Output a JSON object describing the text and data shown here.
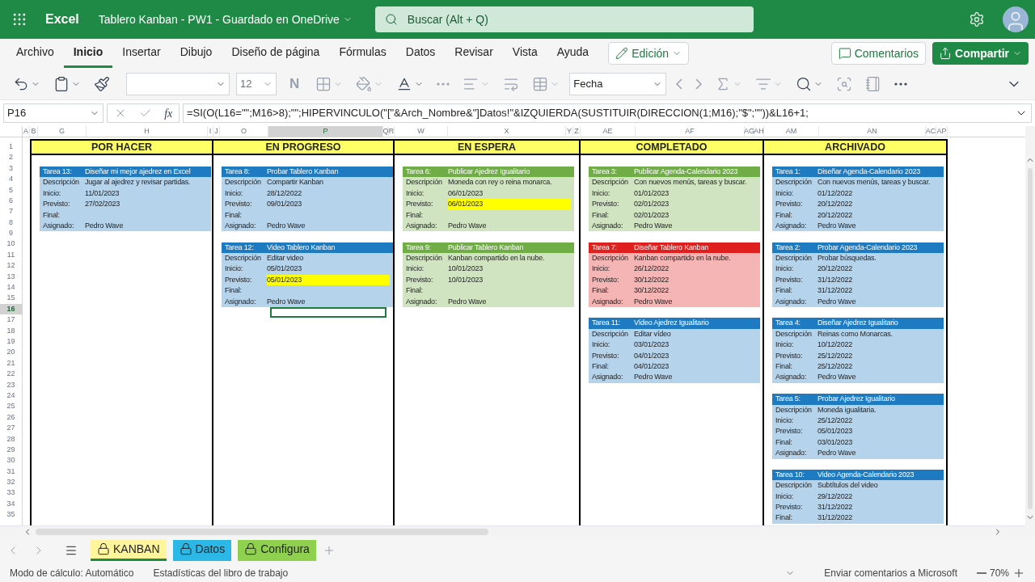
{
  "app": {
    "name": "Excel",
    "doc_title": "Tablero Kanban - PW1  -  Guardado en OneDrive",
    "search_placeholder": "Buscar (Alt + Q)"
  },
  "ribbon_tabs": [
    {
      "label": "Archivo",
      "selected": false
    },
    {
      "label": "Inicio",
      "selected": true
    },
    {
      "label": "Insertar",
      "selected": false
    },
    {
      "label": "Dibujo",
      "selected": false
    },
    {
      "label": "Diseño de página",
      "selected": false
    },
    {
      "label": "Fórmulas",
      "selected": false
    },
    {
      "label": "Datos",
      "selected": false
    },
    {
      "label": "Revisar",
      "selected": false
    },
    {
      "label": "Vista",
      "selected": false
    },
    {
      "label": "Ayuda",
      "selected": false
    }
  ],
  "edit_mode": "Edición",
  "comments_button": "Comentarios",
  "share_button": "Compartir",
  "toolbar": {
    "font_size": "12",
    "bold": "N",
    "number_format": "Fecha"
  },
  "formula_bar": {
    "name_box": "P16",
    "fx": "fx",
    "formula": "=SI(O(L16=\"\";M16>8);\"\";HIPERVINCULO(\"[\"&Arch_Nombre&\"]Datos!\"&IZQUIERDA(SUSTITUIR(DIRECCION(1;M16);\"$\";\"\"))&L16+1;"
  },
  "column_headers": [
    {
      "label": "A",
      "selected": false
    },
    {
      "label": "B",
      "selected": false
    },
    {
      "label": "G",
      "selected": false
    },
    {
      "label": "H",
      "selected": false
    },
    {
      "label": "I",
      "selected": false
    },
    {
      "label": "J",
      "selected": false
    },
    {
      "label": "O",
      "selected": false
    },
    {
      "label": "P",
      "selected": true
    },
    {
      "label": "Q",
      "selected": false
    },
    {
      "label": "R",
      "selected": false
    },
    {
      "label": "W",
      "selected": false
    },
    {
      "label": "X",
      "selected": false
    },
    {
      "label": "Y",
      "selected": false
    },
    {
      "label": "Z",
      "selected": false
    },
    {
      "label": "AE",
      "selected": false
    },
    {
      "label": "AF",
      "selected": false
    },
    {
      "label": "AG",
      "selected": false
    },
    {
      "label": "AH",
      "selected": false
    },
    {
      "label": "AM",
      "selected": false
    },
    {
      "label": "AN",
      "selected": false
    },
    {
      "label": "AC",
      "selected": false
    },
    {
      "label": "AP",
      "selected": false
    }
  ],
  "row_headers": [
    {
      "label": "1",
      "selected": false
    },
    {
      "label": "2",
      "selected": false
    },
    {
      "label": "3",
      "selected": false
    },
    {
      "label": "4",
      "selected": false
    },
    {
      "label": "5",
      "selected": false
    },
    {
      "label": "6",
      "selected": false
    },
    {
      "label": "7",
      "selected": false
    },
    {
      "label": "8",
      "selected": false
    },
    {
      "label": "9",
      "selected": false
    },
    {
      "label": "10",
      "selected": false
    },
    {
      "label": "11",
      "selected": false
    },
    {
      "label": "12",
      "selected": false
    },
    {
      "label": "13",
      "selected": false
    },
    {
      "label": "14",
      "selected": false
    },
    {
      "label": "15",
      "selected": false
    },
    {
      "label": "16",
      "selected": true
    },
    {
      "label": "17",
      "selected": false
    },
    {
      "label": "18",
      "selected": false
    },
    {
      "label": "19",
      "selected": false
    },
    {
      "label": "20",
      "selected": false
    },
    {
      "label": "21",
      "selected": false
    },
    {
      "label": "22",
      "selected": false
    },
    {
      "label": "23",
      "selected": false
    },
    {
      "label": "24",
      "selected": false
    },
    {
      "label": "25",
      "selected": false
    },
    {
      "label": "26",
      "selected": false
    },
    {
      "label": "27",
      "selected": false
    },
    {
      "label": "28",
      "selected": false
    },
    {
      "label": "29",
      "selected": false
    },
    {
      "label": "30",
      "selected": false
    },
    {
      "label": "31",
      "selected": false
    },
    {
      "label": "32",
      "selected": false
    },
    {
      "label": "33",
      "selected": false
    },
    {
      "label": "34",
      "selected": false
    },
    {
      "label": "35",
      "selected": false
    }
  ],
  "board": {
    "columns": [
      {
        "title": "POR HACER",
        "active_cell": false,
        "cards": [
          {
            "number": "Tarea 13:",
            "name": "Diseñar mi mejor ajedrez en Excel",
            "color": "#1f7bc1",
            "highlighted": false,
            "fields": [
              {
                "label": "Descripción",
                "value": "Jugar al ajedrez y revisar partidas."
              },
              {
                "label": "Inicio:",
                "value": "11/01/2023"
              },
              {
                "label": "Previsto:",
                "value": "27/02/2023"
              },
              {
                "label": "Final:"
              },
              {
                "label": "Asignado:",
                "value": "Pedro Wave"
              }
            ]
          }
        ]
      },
      {
        "title": "EN PROGRESO",
        "active_cell": true,
        "cards": [
          {
            "number": "Tarea 8:",
            "name": "Probar Tablero Kanban",
            "color": "#1f7bc1",
            "highlighted": false,
            "fields": [
              {
                "label": "Descripción",
                "value": "Compartir Kanban"
              },
              {
                "label": "Inicio:",
                "value": "28/12/2022"
              },
              {
                "label": "Previsto:",
                "value": "09/01/2023"
              },
              {
                "label": "Final:"
              },
              {
                "label": "Asignado:",
                "value": "Pedro Wave"
              }
            ]
          },
          {
            "number": "Tarea 12:",
            "name": "Video Tablero Kanban",
            "color": "#1f7bc1",
            "highlighted": true,
            "fields": [
              {
                "label": "Descripción",
                "value": "Editar video"
              },
              {
                "label": "Inicio:",
                "value": "05/01/2023"
              },
              {
                "label": "Previsto:",
                "value": "05/01/2023"
              },
              {
                "label": "Final:"
              },
              {
                "label": "Asignado:",
                "value": "Pedro Wave"
              }
            ]
          }
        ]
      },
      {
        "title": "EN ESPERA",
        "active_cell": false,
        "cards": [
          {
            "number": "Tarea 6:",
            "name": "Publicar Ajedrez Igualitario",
            "color": "#70ad47",
            "highlighted": true,
            "fields": [
              {
                "label": "Descripción",
                "value": "Moneda con rey o reina monarca."
              },
              {
                "label": "Inicio:",
                "value": "06/01/2023"
              },
              {
                "label": "Previsto:",
                "value": "06/01/2023"
              },
              {
                "label": "Final:"
              },
              {
                "label": "Asignado:",
                "value": "Pedro Wave"
              }
            ]
          },
          {
            "number": "Tarea 9:",
            "name": "Publicar Tablero Kanban",
            "color": "#70ad47",
            "highlighted": false,
            "fields": [
              {
                "label": "Descripción",
                "value": "Kanban compartido en la nube."
              },
              {
                "label": "Inicio:",
                "value": "10/01/2023"
              },
              {
                "label": "Previsto:",
                "value": "10/01/2023"
              },
              {
                "label": "Final:"
              },
              {
                "label": "Asignado:",
                "value": "Pedro Wave"
              }
            ]
          }
        ]
      },
      {
        "title": "COMPLETADO",
        "active_cell": false,
        "cards": [
          {
            "number": "Tarea 3:",
            "name": "Publicar Agenda-Calendario 2023",
            "color": "#70ad47",
            "highlighted": false,
            "fields": [
              {
                "label": "Descripción",
                "value": "Con nuevos menús, tareas y buscar."
              },
              {
                "label": "Inicio:",
                "value": "01/01/2023"
              },
              {
                "label": "Previsto:",
                "value": "02/01/2023"
              },
              {
                "label": "Final:",
                "value": "02/01/2023"
              },
              {
                "label": "Asignado:",
                "value": "Pedro Wave"
              }
            ]
          },
          {
            "number": "Tarea 7:",
            "name": "Diseñar Tablero Kanban",
            "color": "#e0201e",
            "highlighted": false,
            "fields": [
              {
                "label": "Descripción",
                "value": "Kanban compartido en la nube."
              },
              {
                "label": "Inicio:",
                "value": "26/12/2022"
              },
              {
                "label": "Previsto:",
                "value": "30/12/2022"
              },
              {
                "label": "Final:",
                "value": "30/12/2022"
              },
              {
                "label": "Asignado:",
                "value": "Pedro Wave"
              }
            ]
          },
          {
            "number": "Tarea 11:",
            "name": "Vídeo Ajedrez Igualitario",
            "color": "#1f7bc1",
            "highlighted": false,
            "fields": [
              {
                "label": "Descripción",
                "value": "Editar vídeo"
              },
              {
                "label": "Inicio:",
                "value": "03/01/2023"
              },
              {
                "label": "Previsto:",
                "value": "04/01/2023"
              },
              {
                "label": "Final:",
                "value": "04/01/2023"
              },
              {
                "label": "Asignado:",
                "value": "Pedro Wave"
              }
            ]
          }
        ]
      },
      {
        "title": "ARCHIVADO",
        "active_cell": false,
        "cards": [
          {
            "number": "Tarea 1:",
            "name": "Diseñar Agenda-Calendario 2023",
            "color": "#1f7bc1",
            "highlighted": false,
            "fields": [
              {
                "label": "Descripción",
                "value": "Con nuevos menús, tareas y buscar."
              },
              {
                "label": "Inicio:",
                "value": "01/12/2022"
              },
              {
                "label": "Previsto:",
                "value": "20/12/2022"
              },
              {
                "label": "Final:",
                "value": "20/12/2022"
              },
              {
                "label": "Asignado:",
                "value": "Pedro Wave"
              }
            ]
          },
          {
            "number": "Tarea 2:",
            "name": "Probar Agenda-Calendario 2023",
            "color": "#1f7bc1",
            "highlighted": false,
            "fields": [
              {
                "label": "Descripción",
                "value": "Probar búsquedas."
              },
              {
                "label": "Inicio:",
                "value": "20/12/2022"
              },
              {
                "label": "Previsto:",
                "value": "31/12/2022"
              },
              {
                "label": "Final:",
                "value": "31/12/2022"
              },
              {
                "label": "Asignado:",
                "value": "Pedro Wave"
              }
            ]
          },
          {
            "number": "Tarea 4:",
            "name": "Diseñar Ajedrez Igualitario",
            "color": "#1f7bc1",
            "highlighted": false,
            "fields": [
              {
                "label": "Descripción",
                "value": "Reinas como Monarcas."
              },
              {
                "label": "Inicio:",
                "value": "10/12/2022"
              },
              {
                "label": "Previsto:",
                "value": "25/12/2022"
              },
              {
                "label": "Final:",
                "value": "25/12/2022"
              },
              {
                "label": "Asignado:",
                "value": "Pedro Wave"
              }
            ]
          },
          {
            "number": "Tarea 5:",
            "name": "Probar Ajedrez Igualitario",
            "color": "#1f7bc1",
            "highlighted": false,
            "fields": [
              {
                "label": "Descripción",
                "value": "Moneda igualitaria."
              },
              {
                "label": "Inicio:",
                "value": "25/12/2022"
              },
              {
                "label": "Previsto:",
                "value": "05/01/2023"
              },
              {
                "label": "Final:",
                "value": "03/01/2023"
              },
              {
                "label": "Asignado:",
                "value": "Pedro Wave"
              }
            ]
          },
          {
            "number": "Tarea 10:",
            "name": "Video Agenda-Calendario 2023",
            "color": "#1f7bc1",
            "highlighted": false,
            "fields": [
              {
                "label": "Descripción",
                "value": "Subtítulos del video"
              },
              {
                "label": "Inicio:",
                "value": "29/12/2022"
              },
              {
                "label": "Previsto:",
                "value": "31/12/2022"
              },
              {
                "label": "Final:",
                "value": "31/12/2022"
              }
            ]
          }
        ]
      }
    ]
  },
  "sheet_tabs": [
    {
      "label": "KANBAN",
      "selected": true,
      "color": "#fff59d"
    },
    {
      "label": "Datos",
      "selected": false,
      "color": "#2bb8e6"
    },
    {
      "label": "Configura",
      "selected": false,
      "color": "#8fd14f"
    }
  ],
  "status_bar": {
    "calc_mode": "Modo de cálculo: Automático",
    "stats": "Estadísticas del libro de trabajo",
    "feedback": "Enviar comentarios a Microsoft",
    "zoom": "70%"
  }
}
